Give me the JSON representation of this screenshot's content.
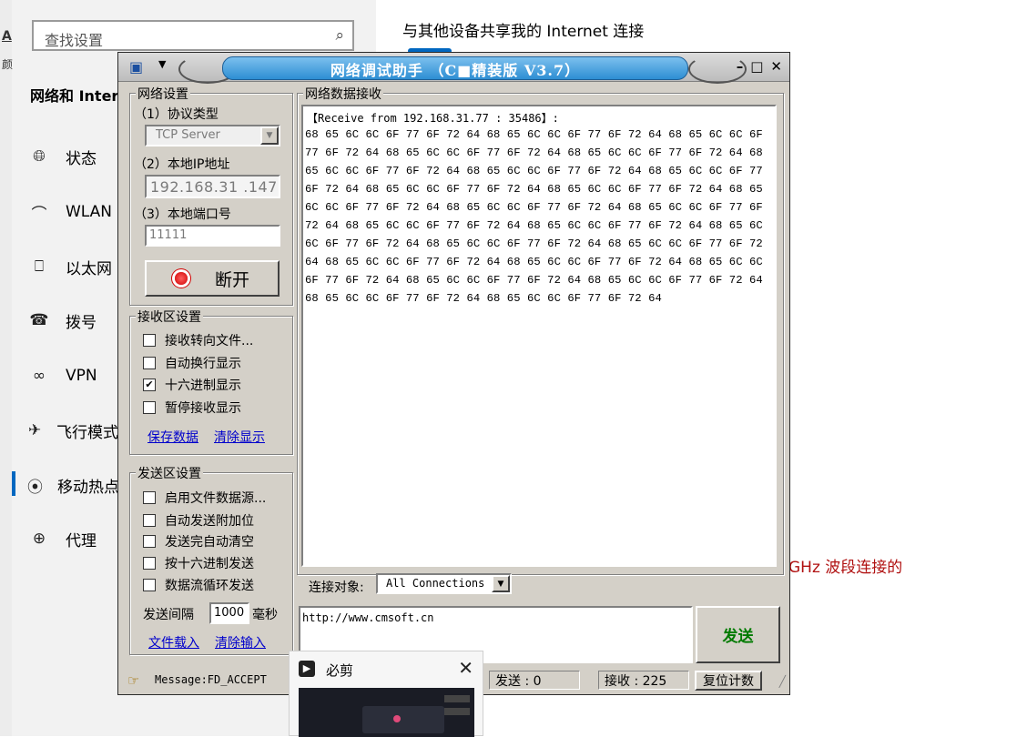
{
  "settings": {
    "search_placeholder": "查找设置",
    "nav_heading": "网络和 Internet",
    "nav_items": [
      {
        "label": "状态",
        "icon": "globe-icon"
      },
      {
        "label": "WLAN",
        "icon": "wifi-icon"
      },
      {
        "label": "以太网",
        "icon": "ethernet-icon"
      },
      {
        "label": "拨号",
        "icon": "dialup-icon"
      },
      {
        "label": "VPN",
        "icon": "vpn-icon"
      },
      {
        "label": "飞行模式",
        "icon": "airplane-icon"
      },
      {
        "label": "移动热点",
        "icon": "hotspot-icon"
      },
      {
        "label": "代理",
        "icon": "proxy-globe-icon"
      }
    ],
    "active_item": "移动热点",
    "right_heading": "与其他设备共享我的 Internet 连接",
    "right_ghz_text": "GHz 波段连接的",
    "accent_color": "#0067c0"
  },
  "app": {
    "title": "网络调试助手 （C■精装版 V3.7）",
    "net_settings": {
      "group_title": "网络设置",
      "protocol_label": "（1）协议类型",
      "protocol_value": "TCP Server",
      "local_ip_label": "（2）本地IP地址",
      "ip_parts": [
        "192",
        "168",
        "31",
        "147"
      ],
      "port_label": "（3）本地端口号",
      "port_value": "11111",
      "disconnect_label": "断开"
    },
    "recv_settings": {
      "group_title": "接收区设置",
      "options": [
        {
          "label": "接收转向文件...",
          "checked": false
        },
        {
          "label": "自动换行显示",
          "checked": false
        },
        {
          "label": "十六进制显示",
          "checked": true
        },
        {
          "label": "暂停接收显示",
          "checked": false
        }
      ],
      "save_link": "保存数据",
      "clear_link": "清除显示"
    },
    "send_settings": {
      "group_title": "发送区设置",
      "options": [
        {
          "label": "启用文件数据源...",
          "checked": false
        },
        {
          "label": "自动发送附加位",
          "checked": false
        },
        {
          "label": "发送完自动清空",
          "checked": false
        },
        {
          "label": "按十六进制发送",
          "checked": false
        },
        {
          "label": "数据流循环发送",
          "checked": false
        }
      ],
      "interval_label": "发送间隔",
      "interval_value": "1000",
      "interval_unit": "毫秒",
      "load_file_link": "文件载入",
      "clear_input_link": "清除输入"
    },
    "receive": {
      "group_title": "网络数据接收",
      "header": "【Receive from 192.168.31.77 : 35486】:",
      "hex_lines": [
        "68 65 6C 6C 6F 77 6F 72 64 68 65 6C 6C 6F 77 6F 72 64 68 65 6C 6C 6F",
        "77 6F 72 64 68 65 6C 6C 6F 77 6F 72 64 68 65 6C 6C 6F 77 6F 72 64 68",
        "65 6C 6C 6F 77 6F 72 64 68 65 6C 6C 6F 77 6F 72 64 68 65 6C 6C 6F 77",
        "6F 72 64 68 65 6C 6C 6F 77 6F 72 64 68 65 6C 6C 6F 77 6F 72 64 68 65",
        "6C 6C 6F 77 6F 72 64 68 65 6C 6C 6F 77 6F 72 64 68 65 6C 6C 6F 77 6F",
        "72 64 68 65 6C 6C 6F 77 6F 72 64 68 65 6C 6C 6F 77 6F 72 64 68 65 6C",
        "6C 6F 77 6F 72 64 68 65 6C 6C 6F 77 6F 72 64 68 65 6C 6C 6F 77 6F 72",
        "64 68 65 6C 6C 6F 77 6F 72 64 68 65 6C 6C 6F 77 6F 72 64 68 65 6C 6C",
        "6F 77 6F 72 64 68 65 6C 6C 6F 77 6F 72 64 68 65 6C 6C 6F 77 6F 72 64",
        "68 65 6C 6C 6F 77 6F 72 64 68 65 6C 6C 6F 77 6F 72 64"
      ]
    },
    "connection_label": "连接对象:",
    "connection_value": "All Connections",
    "send_text": "http://www.cmsoft.cn",
    "send_button": "发送",
    "status": {
      "message": "Message:FD_ACCEPT",
      "sent": "发送 : 0",
      "received": "接收 : 225",
      "reset": "复位计数"
    }
  },
  "bijian_popup": {
    "title": "必剪"
  }
}
